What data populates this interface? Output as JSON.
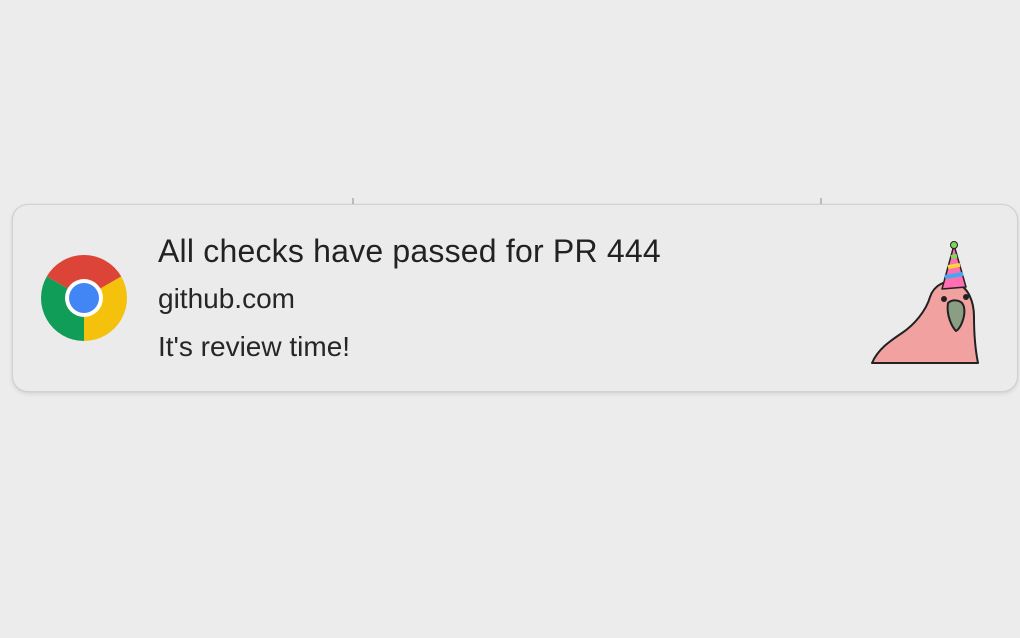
{
  "notification": {
    "app_icon": "chrome-icon",
    "title": "All checks have passed for PR 444",
    "source": "github.com",
    "body": "It's review time!",
    "attachment_image": "party-parrot-image"
  },
  "colors": {
    "background": "#ececec",
    "card": "#ebebeb",
    "chrome_red": "#db4437",
    "chrome_yellow": "#f4c20d",
    "chrome_green": "#0f9d58",
    "chrome_blue": "#4285f4",
    "parrot_pink": "#f2a1a1",
    "parrot_beak": "#8a9e84"
  }
}
